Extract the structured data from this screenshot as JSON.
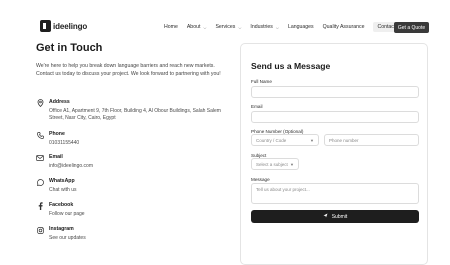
{
  "header": {
    "logo_text": "ideelingo",
    "nav": [
      {
        "label": "Home",
        "has_menu": false
      },
      {
        "label": "About",
        "has_menu": true
      },
      {
        "label": "Services",
        "has_menu": true
      },
      {
        "label": "Industries",
        "has_menu": true
      },
      {
        "label": "Languages",
        "has_menu": false
      },
      {
        "label": "Quality Assurance",
        "has_menu": false
      },
      {
        "label": "Contact",
        "has_menu": false
      }
    ],
    "quote_button": "Get a Quote"
  },
  "contact": {
    "title": "Get in Touch",
    "intro": "We're here to help you break down language barriers and reach new markets. Contact us today to discuss your project. We look forward to partnering with you!",
    "items": [
      {
        "icon": "location-pin-icon",
        "label": "Address",
        "text": "Office A1, Apartment 9, 7th Floor, Building 4, Al Obour Buildings, Salah Salem Street, Nasr City, Cairo, Egypt"
      },
      {
        "icon": "phone-icon",
        "label": "Phone",
        "text": "01031155440"
      },
      {
        "icon": "mail-icon",
        "label": "Email",
        "text": "info@ideelingo.com"
      },
      {
        "icon": "whatsapp-icon",
        "label": "WhatsApp",
        "text": "Chat with us"
      },
      {
        "icon": "facebook-icon",
        "label": "Facebook",
        "text": "Follow our page"
      },
      {
        "icon": "instagram-icon",
        "label": "Instagram",
        "text": "See our updates"
      }
    ]
  },
  "form": {
    "title": "Send us a Message",
    "full_name_label": "Full Name",
    "email_label": "Email",
    "phone_label": "Phone Number (Optional)",
    "country_code_placeholder": "Country / Code",
    "phone_placeholder": "Phone number",
    "subject_label": "Subject",
    "subject_placeholder": "Select a subject",
    "message_label": "Message",
    "message_placeholder": "Tell us about your project...",
    "submit_label": "Submit"
  }
}
